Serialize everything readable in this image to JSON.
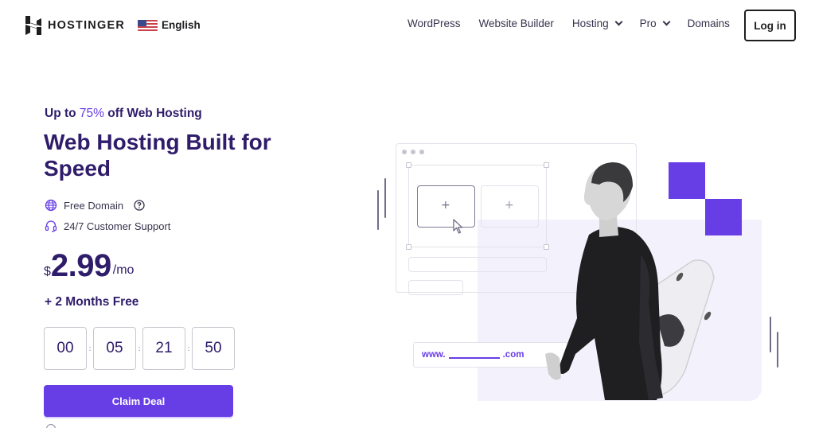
{
  "header": {
    "logo_text": "HOSTINGER",
    "language": {
      "label": "English",
      "flag": "us-flag-icon"
    },
    "nav": [
      {
        "label": "WordPress",
        "has_dropdown": false
      },
      {
        "label": "Website Builder",
        "has_dropdown": false
      },
      {
        "label": "Hosting",
        "has_dropdown": true
      },
      {
        "label": "Pro",
        "has_dropdown": true
      },
      {
        "label": "Domains",
        "has_dropdown": false
      }
    ],
    "login_label": "Log in"
  },
  "hero": {
    "promo_prefix": "Up to ",
    "promo_accent": "75%",
    "promo_suffix": " off Web Hosting",
    "title": "Web Hosting Built for Speed",
    "features": [
      {
        "icon": "globe-icon",
        "label": "Free Domain",
        "help_icon": "question-circle-icon"
      },
      {
        "icon": "headset-icon",
        "label": "24/7 Customer Support"
      }
    ],
    "price": {
      "currency": "$",
      "amount": "2.99",
      "period": "/mo"
    },
    "bonus": "+ 2 Months Free",
    "countdown": [
      "00",
      "05",
      "21",
      "50"
    ],
    "countdown_separator": ":",
    "cta_label": "Claim Deal"
  },
  "illustration": {
    "domain_prefix": "www.",
    "domain_suffix": ".com"
  },
  "colors": {
    "brand": "#673de6",
    "heading": "#2f1c6a",
    "lavender": "#f3f2fc"
  }
}
